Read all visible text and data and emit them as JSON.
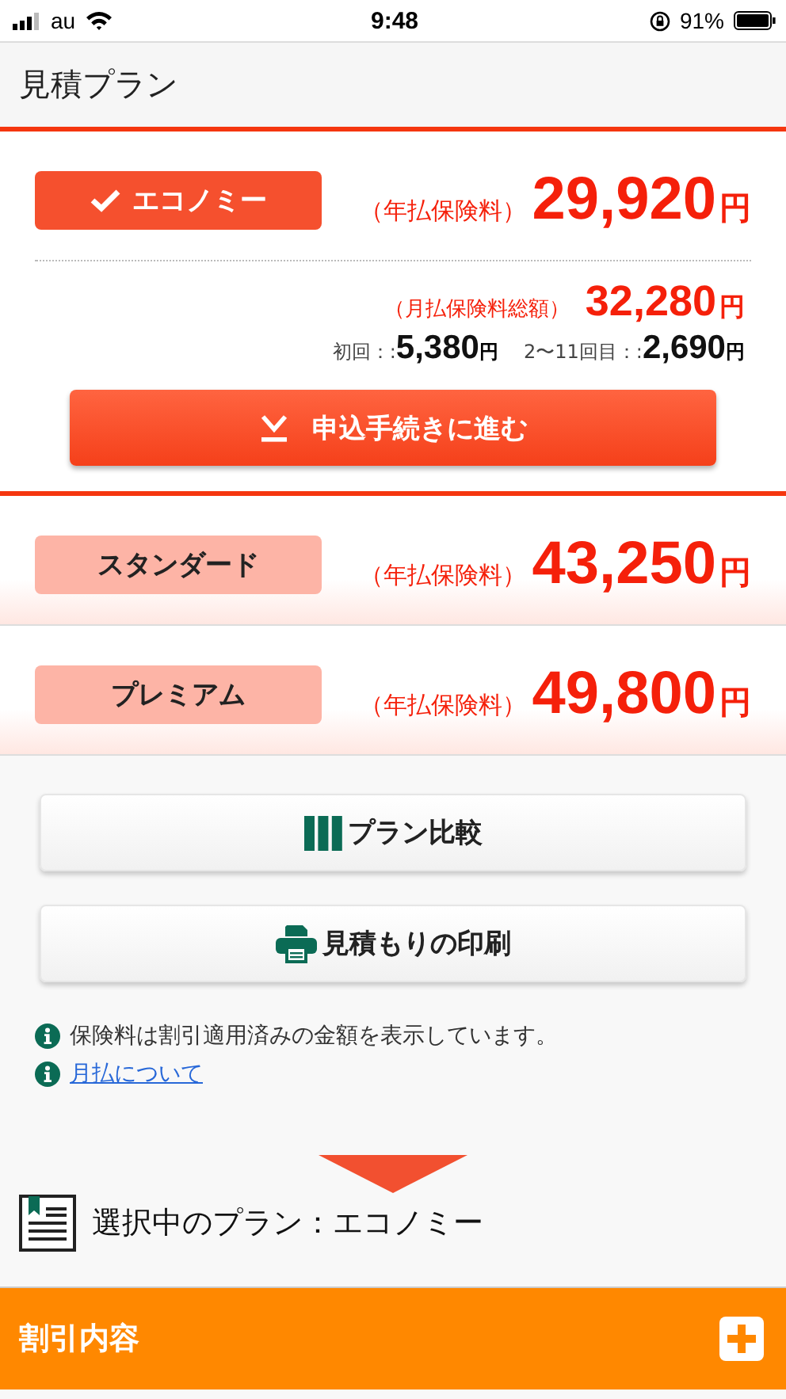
{
  "status_bar": {
    "carrier": "au",
    "time": "9:48",
    "battery": "91%"
  },
  "header": {
    "title": "見積プラン"
  },
  "plans": [
    {
      "name": "エコノミー",
      "price_label": "（年払保険料）",
      "price": "29,920",
      "unit": "円",
      "selected": true
    },
    {
      "name": "スタンダード",
      "price_label": "（年払保険料）",
      "price": "43,250",
      "unit": "円",
      "selected": false
    },
    {
      "name": "プレミアム",
      "price_label": "（年払保険料）",
      "price": "49,800",
      "unit": "円",
      "selected": false
    }
  ],
  "monthly": {
    "label": "（月払保険料総額）",
    "total": "32,280",
    "unit": "円",
    "installments": [
      {
        "label": "初回：:",
        "amount": "5,380",
        "unit": "円"
      },
      {
        "label": "2〜11回目：:",
        "amount": "2,690",
        "unit": "円"
      }
    ]
  },
  "apply_button": "申込手続きに進む",
  "actions": [
    {
      "kind": "compare",
      "label": "プラン比較"
    },
    {
      "kind": "print",
      "label": "見積もりの印刷"
    }
  ],
  "notes": [
    {
      "kind": "text",
      "text": "保険料は割引適用済みの金額を表示しています。"
    },
    {
      "kind": "link",
      "text": "月払について"
    }
  ],
  "selected_plan": "選択中のプラン：エコノミー",
  "discount_bar": {
    "title": "割引内容",
    "expanded": false
  }
}
